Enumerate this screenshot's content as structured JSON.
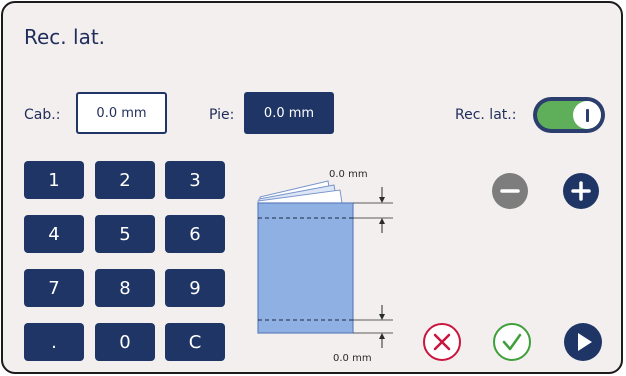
{
  "title": "Rec. lat.",
  "fields": {
    "cab_label": "Cab.:",
    "cab_value": "0.0 mm",
    "pie_label": "Pie:",
    "pie_value": "0.0 mm"
  },
  "toggle": {
    "label": "Rec. lat.:",
    "state": "on",
    "track_color": "#5fae5a"
  },
  "keypad": [
    "1",
    "2",
    "3",
    "4",
    "5",
    "6",
    "7",
    "8",
    "9",
    ".",
    "0",
    "C"
  ],
  "diagram": {
    "top_value": "0.0 mm",
    "bottom_value": "0.0 mm"
  },
  "buttons": {
    "minus_icon": "minus-icon",
    "plus_icon": "plus-icon",
    "cancel_icon": "x-icon",
    "confirm_icon": "check-icon",
    "play_icon": "play-icon"
  },
  "colors": {
    "navy": "#1f3566",
    "accent_red": "#c8163f",
    "accent_green": "#3f9f3b",
    "disabled": "#7d7d7d"
  }
}
